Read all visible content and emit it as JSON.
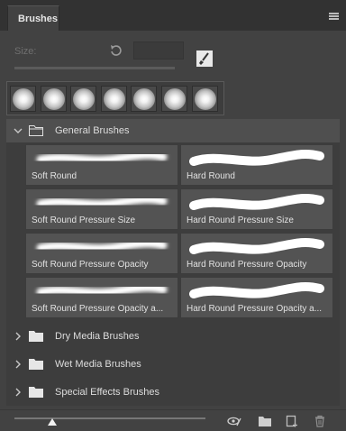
{
  "panel": {
    "tab_label": "Brushes",
    "size_label": "Size:",
    "size_value": ""
  },
  "presets": {
    "count": 7
  },
  "groups": [
    {
      "label": "General Brushes",
      "expanded": true,
      "brushes": [
        {
          "label": "Soft Round",
          "stroke": "soft"
        },
        {
          "label": "Hard Round",
          "stroke": "hard"
        },
        {
          "label": "Soft Round Pressure Size",
          "stroke": "soft"
        },
        {
          "label": "Hard Round Pressure Size",
          "stroke": "hard"
        },
        {
          "label": "Soft Round Pressure Opacity",
          "stroke": "soft"
        },
        {
          "label": "Hard Round Pressure Opacity",
          "stroke": "hard"
        },
        {
          "label": "Soft Round Pressure Opacity a...",
          "stroke": "soft"
        },
        {
          "label": "Hard Round Pressure Opacity a...",
          "stroke": "hard"
        }
      ]
    },
    {
      "label": "Dry Media Brushes",
      "expanded": false
    },
    {
      "label": "Wet Media Brushes",
      "expanded": false
    },
    {
      "label": "Special Effects Brushes",
      "expanded": false
    }
  ],
  "footer": {
    "thumbnail_size_fraction": 0.2,
    "icons": [
      "toggle-visibility-icon",
      "new-group-icon",
      "new-brush-icon",
      "delete-icon"
    ]
  },
  "colors": {
    "background": "#424242",
    "header": "#323232",
    "tile": "#535353",
    "text": "#dddddd"
  }
}
